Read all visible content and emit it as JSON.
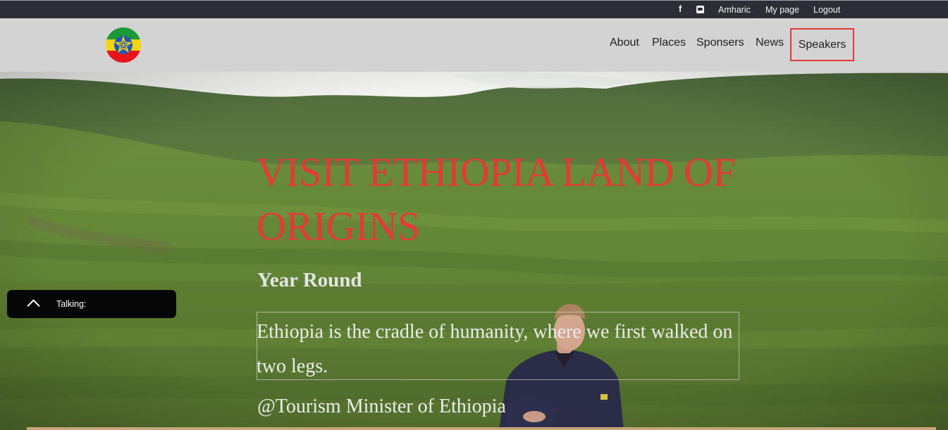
{
  "topbar": {
    "facebook_icon": "facebook-icon",
    "twitter_icon": "twitter-icon",
    "links": {
      "amharic": "Amharic",
      "my_page": "My page",
      "logout": "Logout"
    }
  },
  "navbar": {
    "logo_icon": "ethiopia-emblem-logo",
    "links": {
      "about": "About",
      "places": "Places",
      "sponsers": "Sponsers",
      "news": "News",
      "speakers": "Speakers"
    },
    "highlight_color": "#e53935"
  },
  "hero": {
    "title": "VISIT ETHIOPIA LAND OF ORIGINS",
    "subtitle": "Year Round",
    "quote": "Ethiopia is the cradle of humanity, where we first walked on two legs.",
    "quote_author": "@Tourism Minister of Ethiopia",
    "title_color": "#e53935"
  },
  "talking_widget": {
    "label": "Talking:",
    "toggle_icon": "chevron-up-icon"
  }
}
